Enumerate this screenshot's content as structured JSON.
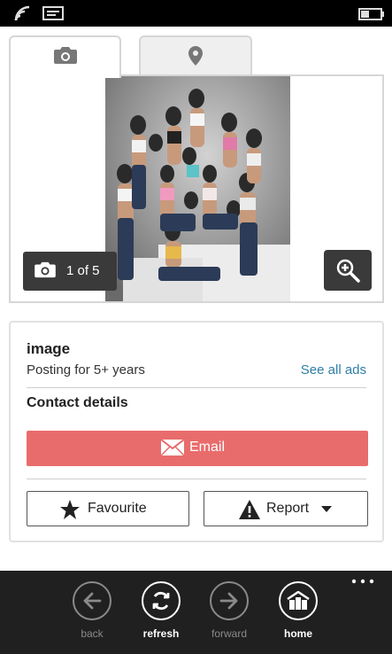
{
  "status_bar": {
    "icons": [
      "signal-icon",
      "message-icon",
      "battery-icon"
    ]
  },
  "tabs": [
    {
      "name": "photos",
      "icon": "camera-icon",
      "active": true
    },
    {
      "name": "location",
      "icon": "map-pin-icon",
      "active": false
    }
  ],
  "gallery": {
    "counter": "1 of 5",
    "zoom_icon": "zoom-in-icon"
  },
  "seller": {
    "name": "image",
    "posting": "Posting for 5+ years",
    "see_all": "See all ads"
  },
  "contact": {
    "heading": "Contact details",
    "email_label": "Email",
    "favourite_label": "Favourite",
    "report_label": "Report"
  },
  "appbar": {
    "buttons": [
      {
        "label": "back",
        "icon": "arrow-left-icon",
        "enabled": false
      },
      {
        "label": "refresh",
        "icon": "refresh-icon",
        "enabled": true
      },
      {
        "label": "forward",
        "icon": "arrow-right-icon",
        "enabled": false
      },
      {
        "label": "home",
        "icon": "home-icon",
        "enabled": true
      }
    ],
    "more": "..."
  },
  "colors": {
    "accent_link": "#2f7fa6",
    "email_button": "#e96c6c",
    "dark_overlay": "#3a3a3a",
    "appbar_bg": "#202020"
  }
}
